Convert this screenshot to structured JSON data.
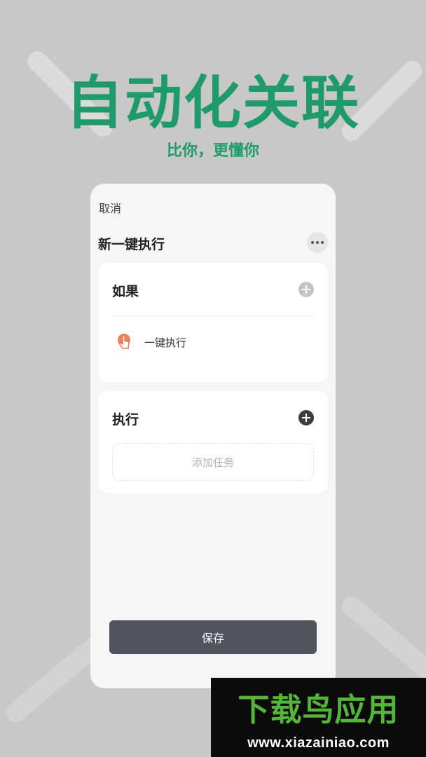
{
  "promo": {
    "title": "自动化关联",
    "subtitle": "比你，更懂你"
  },
  "editor": {
    "cancel_label": "取消",
    "scene_title": "新一键执行",
    "more_icon": "more-icon",
    "if_section": {
      "title": "如果",
      "add_icon": "plus-circle-icon",
      "trigger": {
        "icon": "hand-tap-icon",
        "label": "一键执行"
      }
    },
    "do_section": {
      "title": "执行",
      "add_icon": "plus-circle-icon",
      "add_task_placeholder": "添加任务"
    },
    "save_label": "保存"
  },
  "watermark": {
    "title": "下载鸟应用",
    "url": "www.xiazainiao.com"
  },
  "colors": {
    "brand_green": "#1f9a6a",
    "save_button": "#52535f",
    "trigger_icon": "#e8744f",
    "watermark_green": "#55b43a"
  }
}
